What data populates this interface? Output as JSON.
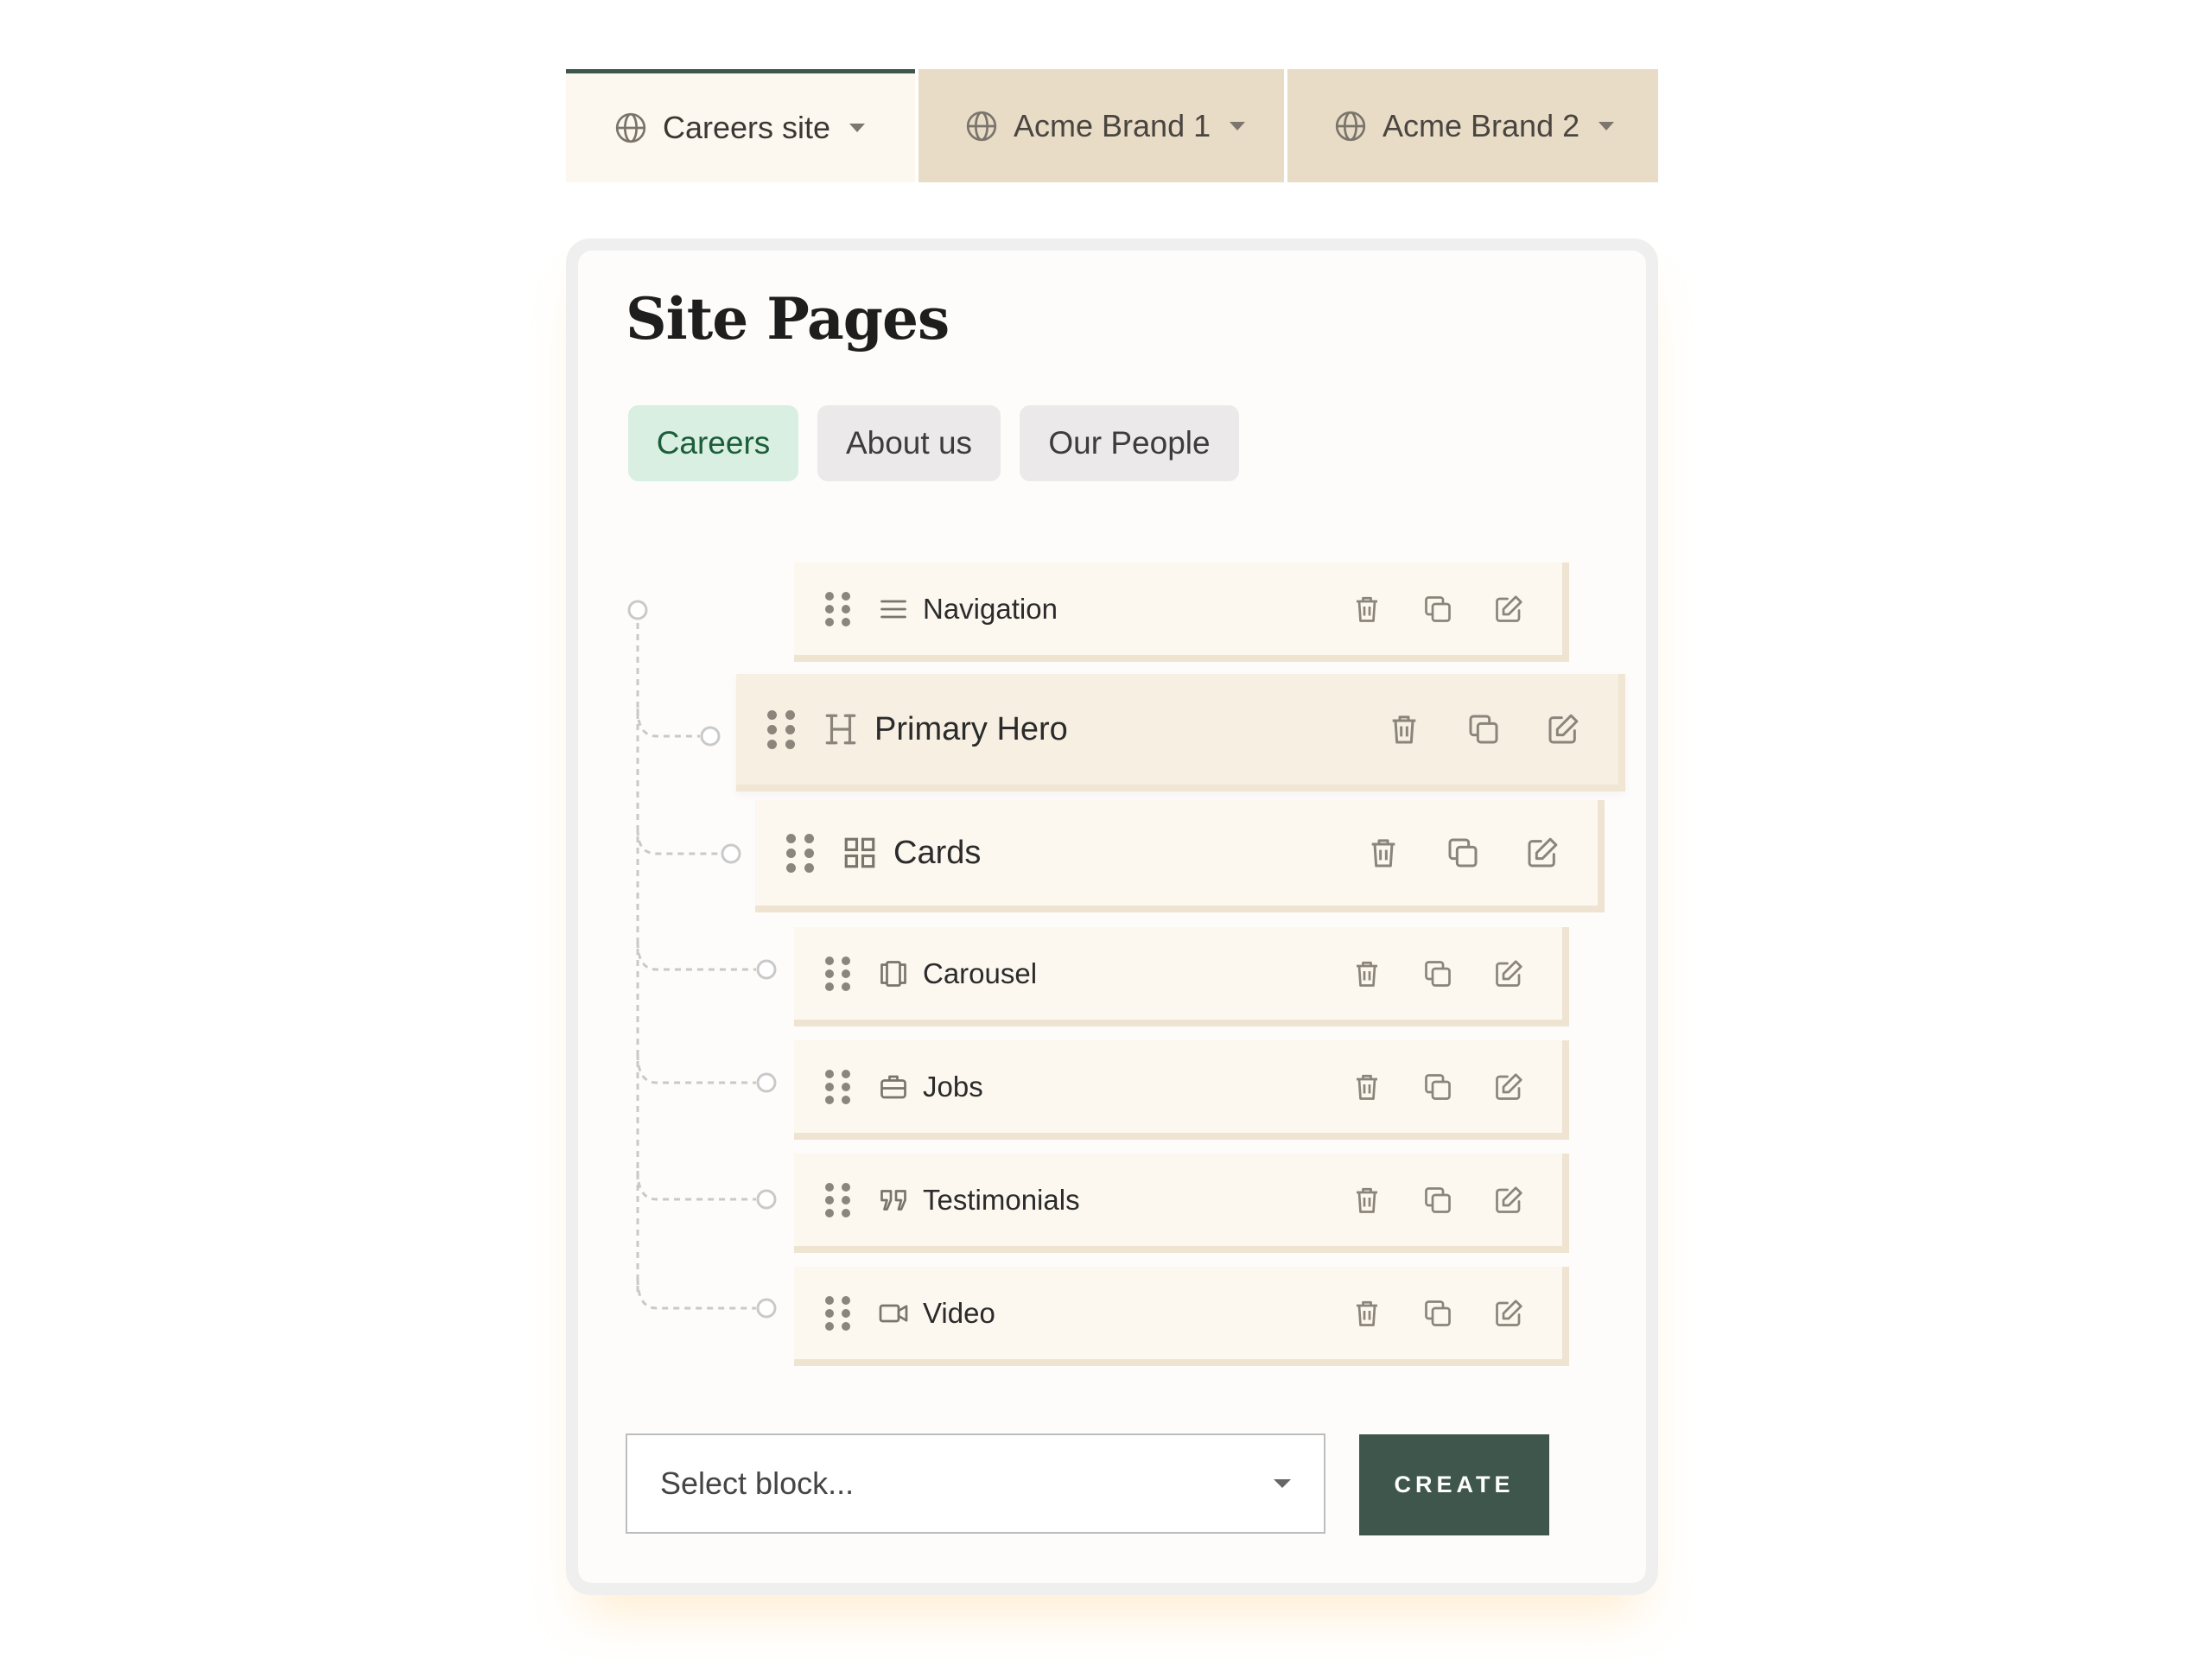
{
  "site_tabs": [
    {
      "label": "Careers site",
      "icon": "globe-icon",
      "active": true
    },
    {
      "label": "Acme Brand 1",
      "icon": "globe-icon",
      "active": false
    },
    {
      "label": "Acme Brand 2",
      "icon": "globe-icon",
      "active": false
    }
  ],
  "panel": {
    "title": "Site Pages"
  },
  "page_tabs": [
    {
      "label": "Careers",
      "active": true
    },
    {
      "label": "About us",
      "active": false
    },
    {
      "label": "Our People",
      "active": false
    }
  ],
  "blocks": [
    {
      "label": "Navigation",
      "icon": "menu-lines-icon"
    },
    {
      "label": "Primary Hero",
      "icon": "heading-icon"
    },
    {
      "label": "Cards",
      "icon": "grid-icon"
    },
    {
      "label": "Carousel",
      "icon": "carousel-icon"
    },
    {
      "label": "Jobs",
      "icon": "briefcase-icon"
    },
    {
      "label": "Testimonials",
      "icon": "quote-icon"
    },
    {
      "label": "Video",
      "icon": "video-icon"
    }
  ],
  "block_actions": [
    "trash-icon",
    "duplicate-icon",
    "edit-icon"
  ],
  "footer": {
    "select_placeholder": "Select block...",
    "create_label": "CREATE"
  },
  "colors": {
    "accent_dark_green": "#3f564d",
    "active_tab_bg": "#d8efe2",
    "active_tab_text": "#1d5e3a",
    "block_bg": "#fcf7ef",
    "inactive_site_tab_bg": "#e8dcc7"
  }
}
